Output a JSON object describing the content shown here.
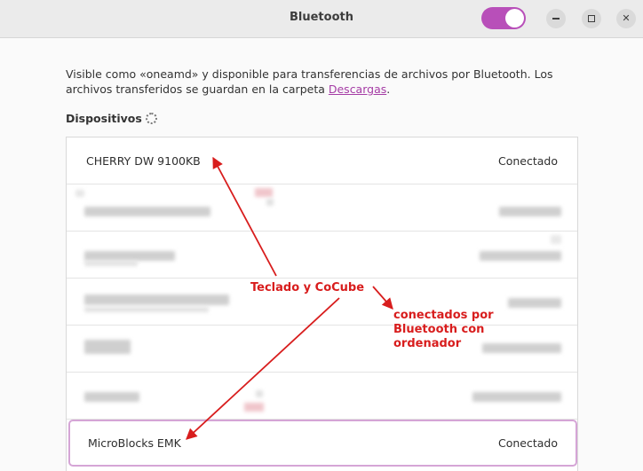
{
  "window": {
    "title": "Bluetooth",
    "bluetooth_enabled": true
  },
  "description": {
    "text": "Visible como «oneamd» y disponible para transferencias de archivos por Bluetooth. Los archivos transferidos se guardan en la carpeta ",
    "link": "Descargas",
    "suffix": "."
  },
  "devices": {
    "section_title": "Dispositivos",
    "items": [
      {
        "name": "CHERRY DW 9100KB",
        "status": "Conectado"
      },
      {
        "name": "",
        "status": ""
      },
      {
        "name": "",
        "status": ""
      },
      {
        "name": "",
        "status": ""
      },
      {
        "name": "",
        "status": ""
      },
      {
        "name": "",
        "status": ""
      },
      {
        "name": "MicroBlocks EMK",
        "status": "Conectado"
      }
    ]
  },
  "annotations": {
    "label1": "Teclado y CoCube",
    "label2_line1": "conectados por",
    "label2_line2": "Bluetooth con",
    "label2_line3": "ordenador",
    "color": "#d81d1d"
  },
  "colors": {
    "accent": "#b84fb9",
    "link": "#a53ca5",
    "highlight_border": "#d5a5d6"
  }
}
